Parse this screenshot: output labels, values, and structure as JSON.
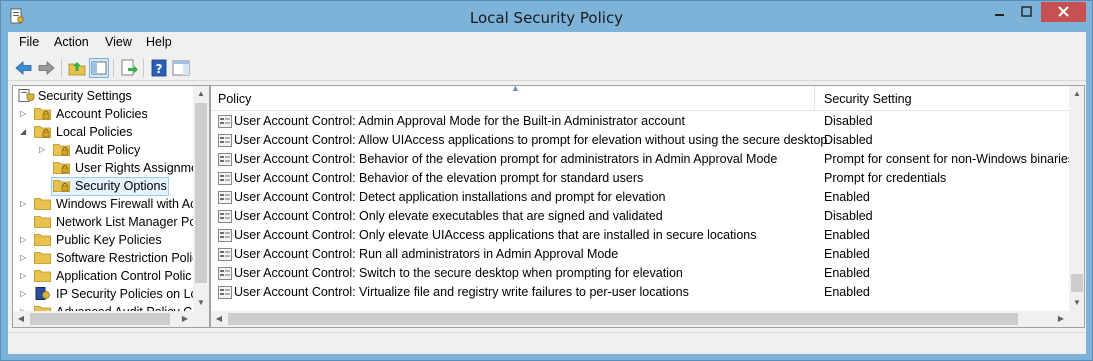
{
  "window": {
    "title": "Local Security Policy"
  },
  "menu": [
    "File",
    "Action",
    "View",
    "Help"
  ],
  "toolbar": {
    "icons": [
      "back-arrow-icon",
      "forward-arrow-icon",
      "up-folder-icon",
      "show-hide-console-tree-icon",
      "export-list-icon",
      "help-icon",
      "show-action-pane-icon"
    ]
  },
  "tree": {
    "root": "Security Settings",
    "items": [
      {
        "label": "Account Policies",
        "expander": "collapsed"
      },
      {
        "label": "Local Policies",
        "expander": "expanded"
      },
      {
        "label": "Audit Policy",
        "expander": "collapsed"
      },
      {
        "label": "User Rights Assignme",
        "expander": "none"
      },
      {
        "label": "Security Options",
        "expander": "none",
        "selected": true
      },
      {
        "label": "Windows Firewall with Ac",
        "expander": "collapsed"
      },
      {
        "label": "Network List Manager Po",
        "expander": "none"
      },
      {
        "label": "Public Key Policies",
        "expander": "collapsed"
      },
      {
        "label": "Software Restriction Polic",
        "expander": "collapsed"
      },
      {
        "label": "Application Control Polic",
        "expander": "collapsed"
      },
      {
        "label": "IP Security Policies on Loc",
        "expander": "collapsed"
      },
      {
        "label": "Advanced Audit Policy C",
        "expander": "collapsed"
      }
    ]
  },
  "list": {
    "columns": [
      "Policy",
      "Security Setting"
    ],
    "rows": [
      {
        "policy": "User Account Control: Admin Approval Mode for the Built-in Administrator account",
        "setting": "Disabled"
      },
      {
        "policy": "User Account Control: Allow UIAccess applications to prompt for elevation without using the secure desktop",
        "setting": "Disabled"
      },
      {
        "policy": "User Account Control: Behavior of the elevation prompt for administrators in Admin Approval Mode",
        "setting": "Prompt for consent for non-Windows binaries"
      },
      {
        "policy": "User Account Control: Behavior of the elevation prompt for standard users",
        "setting": "Prompt for credentials"
      },
      {
        "policy": "User Account Control: Detect application installations and prompt for elevation",
        "setting": "Enabled"
      },
      {
        "policy": "User Account Control: Only elevate executables that are signed and validated",
        "setting": "Disabled"
      },
      {
        "policy": "User Account Control: Only elevate UIAccess applications that are installed in secure locations",
        "setting": "Enabled"
      },
      {
        "policy": "User Account Control: Run all administrators in Admin Approval Mode",
        "setting": "Enabled"
      },
      {
        "policy": "User Account Control: Switch to the secure desktop when prompting for elevation",
        "setting": "Enabled"
      },
      {
        "policy": "User Account Control: Virtualize file and registry write failures to per-user locations",
        "setting": "Enabled"
      }
    ]
  },
  "colors": {
    "titlebar": "#7db3d8",
    "close_button": "#c75050",
    "selection": "#e5f3ff",
    "folder": "#e8c24c"
  }
}
